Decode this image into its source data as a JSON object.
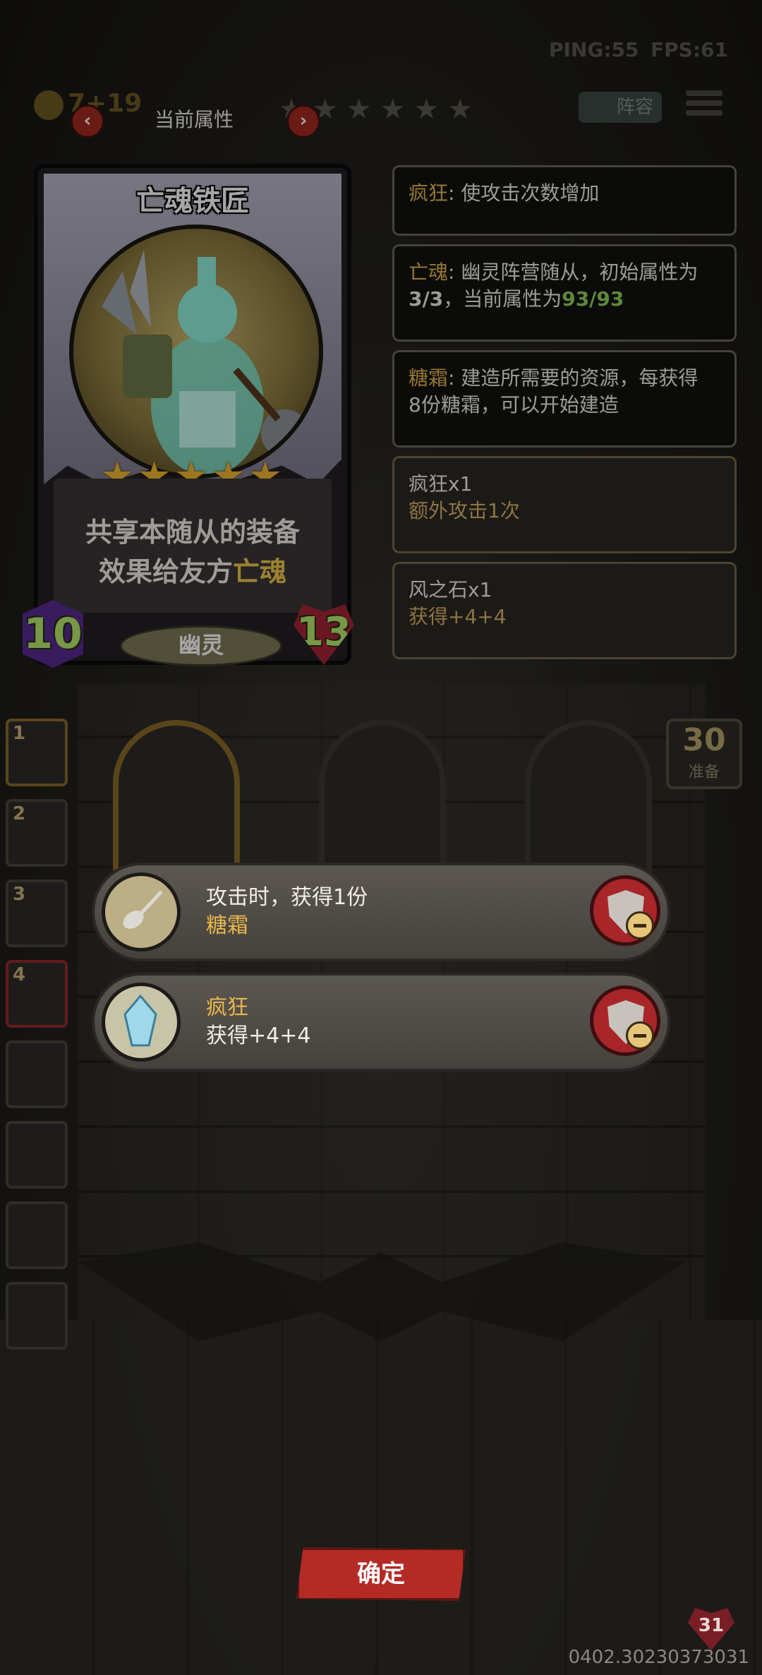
{
  "hud": {
    "ping": "PING:55",
    "fps": "FPS:61",
    "coins": "7+19",
    "lineup_label": "阵容",
    "stars_top": "★★★★★★"
  },
  "panel": {
    "title": "当前属性",
    "prev": "‹",
    "next": "›"
  },
  "card": {
    "name": "亡魂铁匠",
    "stars": "★★★★★",
    "desc_line1": "共享本随从的装备",
    "desc_line2_prefix": "效果给友方",
    "desc_line2_highlight": "亡魂",
    "type": "幽灵",
    "attack": "10",
    "health": "13"
  },
  "info": [
    {
      "key": "疯狂",
      "text": ": 使攻击次数增加"
    },
    {
      "key": "亡魂",
      "text": ": 幽灵阵营随从，初始属性为",
      "line2_a": "3/3",
      "line2_b": "，当前属性为",
      "line2_num": "93/93"
    },
    {
      "key": "糖霜",
      "text": ": 建造所需要的资源，每获得",
      "line2": "8份糖霜，可以开始建造"
    }
  ],
  "buffs": [
    {
      "title": "疯狂x1",
      "sub": "额外攻击1次"
    },
    {
      "title": "风之石x1",
      "sub": "获得+4+4"
    }
  ],
  "side_slots": [
    "1",
    "2",
    "3",
    "4"
  ],
  "prep": {
    "count": "30",
    "label": "准备"
  },
  "items": [
    {
      "line1": "攻击时，获得1份",
      "line2": "糖霜"
    },
    {
      "line1": "疯狂",
      "line2": "获得+4+4"
    }
  ],
  "confirm_label": "确定",
  "bottom_hp": "31",
  "version": "0402.30230373031"
}
